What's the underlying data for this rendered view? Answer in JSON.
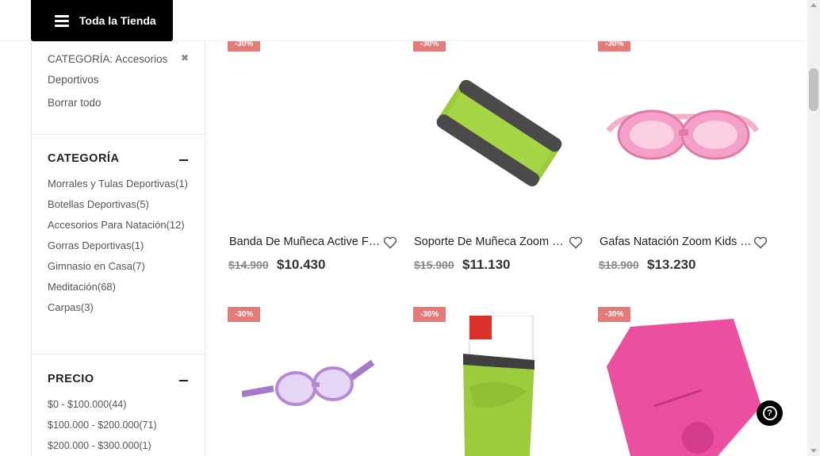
{
  "header": {
    "store_button_label": "Toda la Tienda"
  },
  "sidebar": {
    "active_filter": "CATEGORÍA: Accesorios Deportivos",
    "remove_icon": "✖",
    "clear_all": "Borrar todo",
    "categories": {
      "title": "CATEGORÍA",
      "items": [
        "Morrales y Tulas Deportivas(1)",
        "Botellas Deportivas(5)",
        "Accesorios Para Natación(12)",
        "Gorras Deportivas(1)",
        "Gimnasio en Casa(7)",
        "Meditación(68)",
        "Carpas(3)"
      ]
    },
    "price": {
      "title": "PRECIO",
      "items": [
        "$0 - $100.000(44)",
        "$100.000 - $200.000(71)",
        "$200.000 - $300.000(1)"
      ]
    }
  },
  "products": [
    {
      "badge": "-30%",
      "name": "Banda De Muñeca Active F…",
      "old_price": "$14.900",
      "price": "$10.430"
    },
    {
      "badge": "-30%",
      "name": "Soporte De Muñeca Zoom …",
      "old_price": "$15.900",
      "price": "$11.130"
    },
    {
      "badge": "-30%",
      "name": "Gafas Natación Zoom Kids …",
      "old_price": "$18.900",
      "price": "$13.230"
    },
    {
      "badge": "-30%"
    },
    {
      "badge": "-30%"
    },
    {
      "badge": "-30%"
    }
  ],
  "colors": {
    "badge": "#e57b78",
    "header_button": "#000000",
    "wristband_green": "#9ccc3c",
    "goggles_pink": "#f5a0c8",
    "towel_pink": "#ec4fa0"
  },
  "help_icon": "?"
}
